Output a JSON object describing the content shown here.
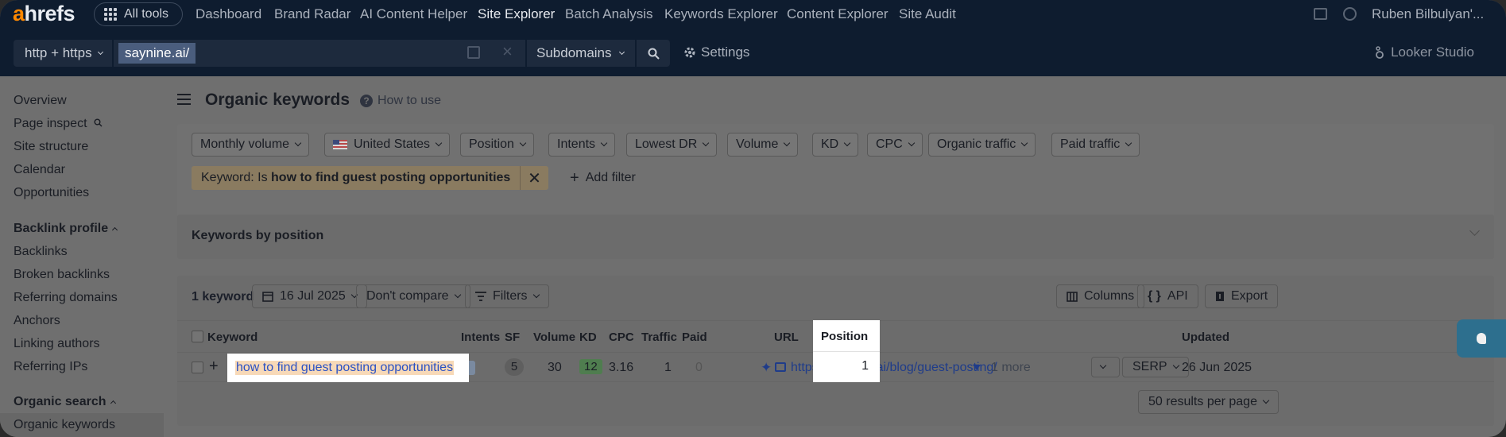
{
  "topnav": {
    "logo_a": "a",
    "logo_rest": "hrefs",
    "all_tools": "All tools",
    "links": [
      "Dashboard",
      "Brand Radar",
      "AI Content Helper",
      "Site Explorer",
      "Batch Analysis",
      "Keywords Explorer",
      "Content Explorer",
      "Site Audit"
    ],
    "active_link": "Site Explorer",
    "user": "Ruben Bilbulyan'..."
  },
  "urlbar": {
    "protocol": "http + https",
    "url": "saynine.ai/",
    "mode": "Subdomains",
    "settings": "Settings",
    "looker": "Looker Studio"
  },
  "sidebar": {
    "items_top": [
      "Overview",
      "Page inspect",
      "Site structure",
      "Calendar",
      "Opportunities"
    ],
    "backlink_head": "Backlink profile",
    "backlink_items": [
      "Backlinks",
      "Broken backlinks",
      "Referring domains",
      "Anchors",
      "Linking authors",
      "Referring IPs"
    ],
    "organic_head": "Organic search",
    "organic_items": [
      "Organic keywords"
    ]
  },
  "page": {
    "title": "Organic keywords",
    "how_to": "How to use"
  },
  "filters": {
    "buttons": [
      "Monthly volume",
      "United States",
      "Position",
      "Intents",
      "Lowest DR",
      "Volume",
      "KD",
      "CPC",
      "Organic traffic",
      "Paid traffic"
    ],
    "active_prefix": "Keyword: Is ",
    "active_value": "how to find guest posting opportunities",
    "add_filter": "Add filter"
  },
  "kbp": {
    "label": "Keywords by position"
  },
  "table": {
    "count": "1 keyword",
    "date": "16 Jul 2025",
    "compare": "Don't compare",
    "filters": "Filters",
    "columns_btn": "Columns",
    "api_btn": "API",
    "export_btn": "Export",
    "headers": [
      "Keyword",
      "Intents",
      "SF",
      "Volume",
      "KD",
      "CPC",
      "Traffic",
      "Paid",
      "Position",
      "URL",
      "Updated"
    ],
    "row": {
      "keyword": "how to find guest posting opportunities",
      "intent": "I",
      "sf": "5",
      "volume": "30",
      "kd": "12",
      "cpc": "3.16",
      "traffic": "1",
      "paid": "0",
      "position": "1",
      "url": "https://saynine.ai/blog/guest-posting/",
      "more": "1 more",
      "serp": "SERP",
      "updated": "26 Jun 2025"
    },
    "per_page": "50 results per page"
  },
  "colors": {
    "nav_bg": "#0e1c2f",
    "overlay": "#6f6f6f",
    "highlight": "#ffffff",
    "accent": "#ff8800"
  }
}
